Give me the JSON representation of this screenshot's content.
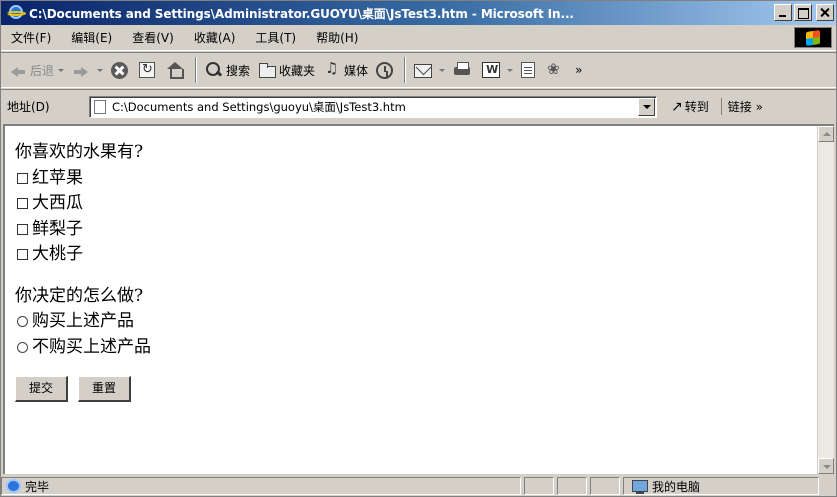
{
  "window": {
    "title": "C:\\Documents and Settings\\Administrator.GUOYU\\桌面\\JsTest3.htm - Microsoft In..."
  },
  "menubar": {
    "items": [
      "文件(F)",
      "编辑(E)",
      "查看(V)",
      "收藏(A)",
      "工具(T)",
      "帮助(H)"
    ]
  },
  "toolbar": {
    "back_label": "后退",
    "search_label": "搜索",
    "favorites_label": "收藏夹",
    "media_label": "媒体",
    "overflow": "»"
  },
  "addressbar": {
    "label": "地址(D)",
    "value": "C:\\Documents and Settings\\guoyu\\桌面\\JsTest3.htm",
    "go_label": "转到",
    "links_label": "链接 »"
  },
  "form": {
    "question1": "你喜欢的水果有?",
    "fruits": [
      "红苹果",
      "大西瓜",
      "鲜梨子",
      "大桃子"
    ],
    "question2": "你决定的怎么做?",
    "choices": [
      "购买上述产品",
      "不购买上述产品"
    ],
    "submit_label": "提交",
    "reset_label": "重置"
  },
  "statusbar": {
    "status_text": "完毕",
    "zone_text": "我的电脑"
  }
}
